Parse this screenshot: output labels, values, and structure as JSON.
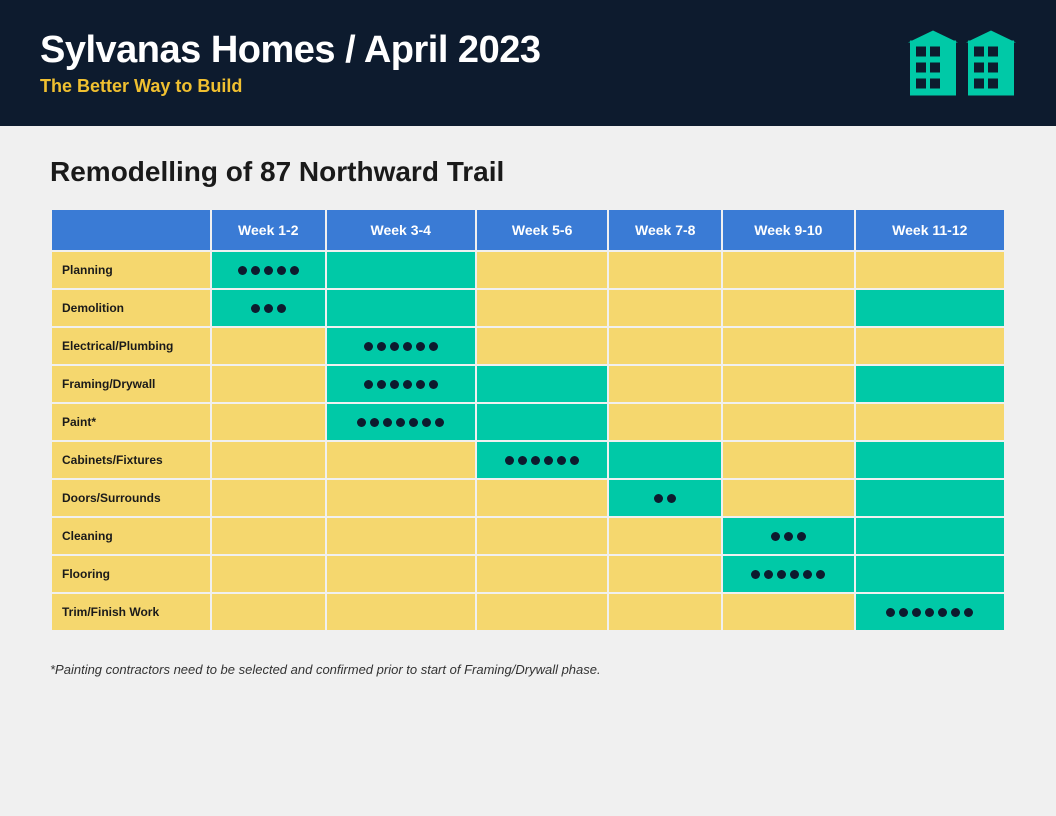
{
  "header": {
    "title": "Sylvanas Homes / April 2023",
    "subtitle": "The Better Way to Build"
  },
  "section_title": "Remodelling of 87 Northward Trail",
  "table": {
    "columns": [
      "",
      "Week 1-2",
      "Week 3-4",
      "Week 5-6",
      "Week 7-8",
      "Week 9-10",
      "Week 11-12"
    ],
    "rows": [
      {
        "label": "Planning",
        "cells": [
          "dots-5",
          "teal",
          "yellow",
          "yellow",
          "yellow",
          "yellow"
        ]
      },
      {
        "label": "Demolition",
        "cells": [
          "dots-3",
          "teal",
          "yellow",
          "yellow",
          "yellow",
          "teal"
        ]
      },
      {
        "label": "Electrical/Plumbing",
        "cells": [
          "yellow",
          "dots-6",
          "yellow",
          "yellow",
          "yellow",
          "yellow"
        ]
      },
      {
        "label": "Framing/Drywall",
        "cells": [
          "yellow",
          "dots-3-then-3",
          "teal",
          "yellow",
          "yellow",
          "teal"
        ]
      },
      {
        "label": "Paint*",
        "cells": [
          "yellow",
          "dots-paint",
          "teal",
          "yellow",
          "yellow",
          "yellow"
        ]
      },
      {
        "label": "Cabinets/Fixtures",
        "cells": [
          "yellow",
          "yellow",
          "dots-6",
          "teal",
          "yellow",
          "teal"
        ]
      },
      {
        "label": "Doors/Surrounds",
        "cells": [
          "yellow",
          "yellow",
          "yellow",
          "dots-2",
          "yellow",
          "teal"
        ]
      },
      {
        "label": "Cleaning",
        "cells": [
          "yellow",
          "yellow",
          "yellow",
          "yellow",
          "dots-3",
          "teal"
        ]
      },
      {
        "label": "Flooring",
        "cells": [
          "yellow",
          "yellow",
          "yellow",
          "yellow",
          "dots-4-then-2",
          "teal"
        ]
      },
      {
        "label": "Trim/Finish Work",
        "cells": [
          "yellow",
          "yellow",
          "yellow",
          "yellow",
          "yellow",
          "dots-7"
        ]
      }
    ]
  },
  "footnote": "*Painting contractors need to be selected and confirmed prior to start of Framing/Drywall phase.",
  "colors": {
    "header_bg": "#0d1b2e",
    "header_text": "#ffffff",
    "subtitle": "#f0c030",
    "col_header": "#3a7bd5",
    "teal": "#00c9a7",
    "yellow": "#f5d76e",
    "dot": "#0d1b2e"
  }
}
